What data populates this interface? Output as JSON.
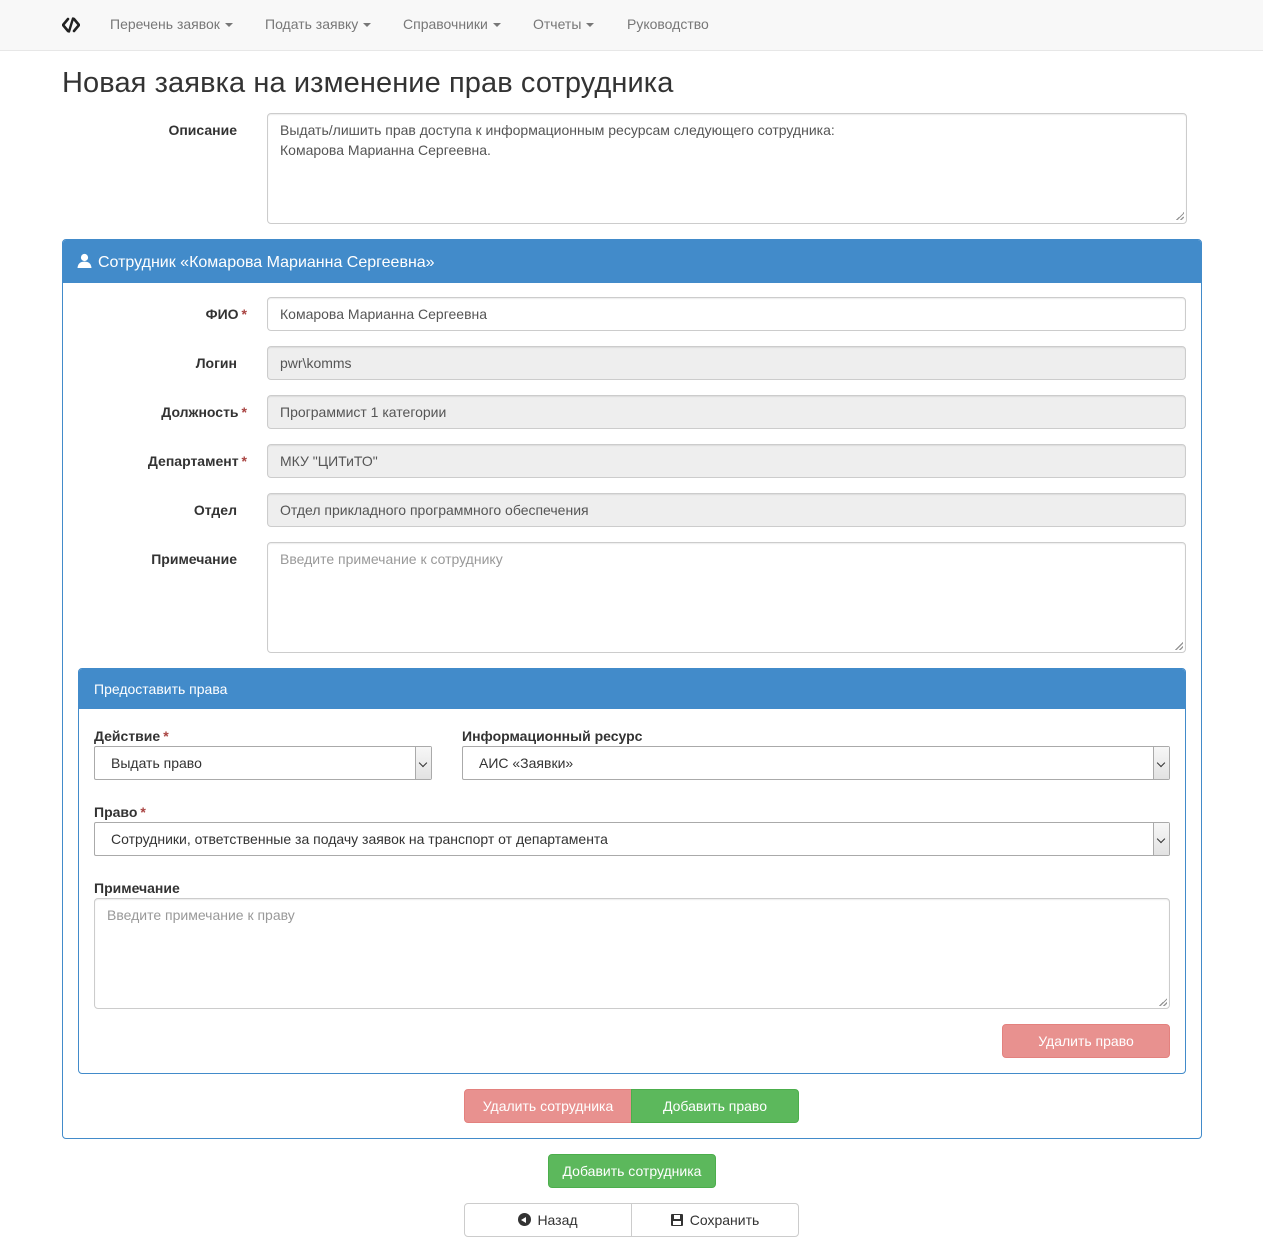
{
  "navbar": {
    "brand_icon": "code-slash-icon",
    "items": [
      {
        "label": "Перечень заявок",
        "dropdown": true
      },
      {
        "label": "Подать заявку",
        "dropdown": true
      },
      {
        "label": "Справочники",
        "dropdown": true
      },
      {
        "label": "Отчеты",
        "dropdown": true
      },
      {
        "label": "Руководство",
        "dropdown": false
      }
    ]
  },
  "page": {
    "title": "Новая заявка на изменение прав сотрудника",
    "description_label": "Описание",
    "description_value": "Выдать/лишить прав доступа к информационным ресурсам следующего сотрудника:\nКомарова Марианна Сергеевна."
  },
  "employee": {
    "header": "Сотрудник «Комарова Марианна Сергеевна»",
    "header_icon": "user-icon",
    "fio_label": "ФИО",
    "fio_value": "Комарова Марианна Сергеевна",
    "login_label": "Логин",
    "login_value": "pwr\\komms",
    "position_label": "Должность",
    "position_value": "Программист 1 категории",
    "department_label": "Департамент",
    "department_value": "МКУ \"ЦИТиТО\"",
    "division_label": "Отдел",
    "division_value": "Отдел прикладного программного обеспечения",
    "note_label": "Примечание",
    "note_placeholder": "Введите примечание к сотруднику",
    "required_mark": "*"
  },
  "right": {
    "header": "Предоставить права",
    "action_label": "Действие",
    "action_value": "Выдать право",
    "resource_label": "Информационный ресурс",
    "resource_value": "АИС «Заявки»",
    "right_label": "Право",
    "right_value": "Сотрудники, ответственные за подачу заявок на транспорт от департамента",
    "note_label": "Примечание",
    "note_placeholder": "Введите примечание к праву",
    "delete_right_button": "Удалить право"
  },
  "buttons": {
    "delete_employee": "Удалить сотрудника",
    "add_right": "Добавить право",
    "add_employee": "Добавить сотрудника",
    "back": "Назад",
    "save": "Сохранить"
  },
  "colors": {
    "primary": "#428bca",
    "success": "#5cb85c",
    "danger_disabled": "#e8918f",
    "required": "#a94442"
  }
}
